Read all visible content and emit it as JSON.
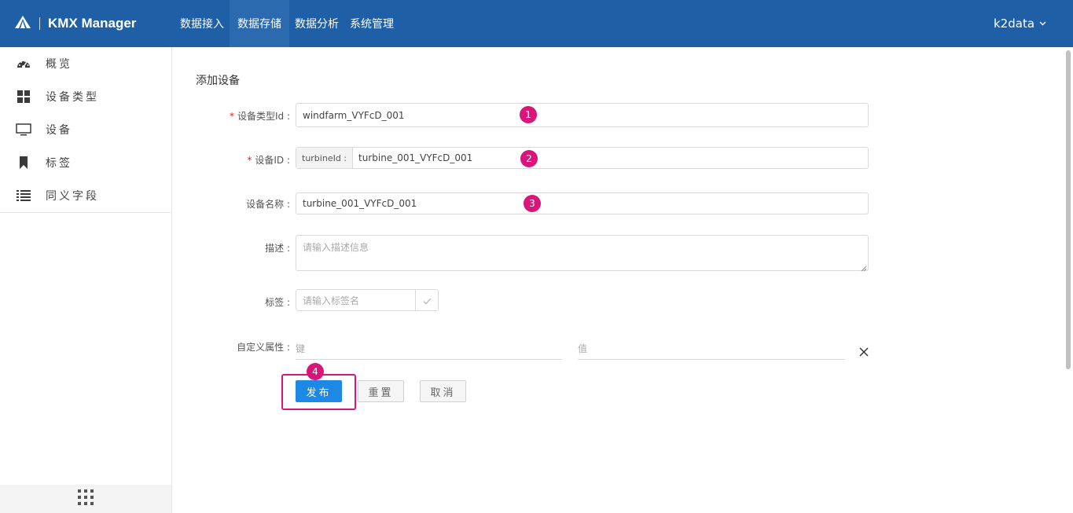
{
  "app": {
    "title": "KMX Manager"
  },
  "nav": {
    "items": [
      {
        "label": "数据接入"
      },
      {
        "label": "数据存储"
      },
      {
        "label": "数据分析"
      },
      {
        "label": "系统管理"
      }
    ],
    "active": "数据存储"
  },
  "user": {
    "name": "k2data"
  },
  "sidebar": {
    "items": [
      {
        "label": "概览",
        "icon": "dashboard-icon"
      },
      {
        "label": "设备类型",
        "icon": "grid-icon"
      },
      {
        "label": "设备",
        "icon": "monitor-icon"
      },
      {
        "label": "标签",
        "icon": "bookmark-icon"
      },
      {
        "label": "同义字段",
        "icon": "list-icon"
      }
    ]
  },
  "form": {
    "title": "添加设备",
    "device_type_id": {
      "label": "设备类型Id",
      "value": "windfarm_VYFcD_001",
      "required": true
    },
    "device_id": {
      "label": "设备ID",
      "prefix": "turbineId :",
      "value": "turbine_001_VYFcD_001",
      "required": true
    },
    "device_name": {
      "label": "设备名称",
      "value": "turbine_001_VYFcD_001"
    },
    "description": {
      "label": "描述",
      "placeholder": "请输入描述信息"
    },
    "tags": {
      "label": "标签",
      "placeholder": "请输入标签名"
    },
    "custom_attrs": {
      "label": "自定义属性",
      "key_placeholder": "键",
      "value_placeholder": "值"
    },
    "buttons": {
      "publish": "发布",
      "reset": "重置",
      "cancel": "取消"
    }
  },
  "annotations": [
    "1",
    "2",
    "3",
    "4"
  ],
  "colors": {
    "header": "#1f5fa6",
    "primary": "#1e88e5",
    "annotation": "#d9147a"
  }
}
